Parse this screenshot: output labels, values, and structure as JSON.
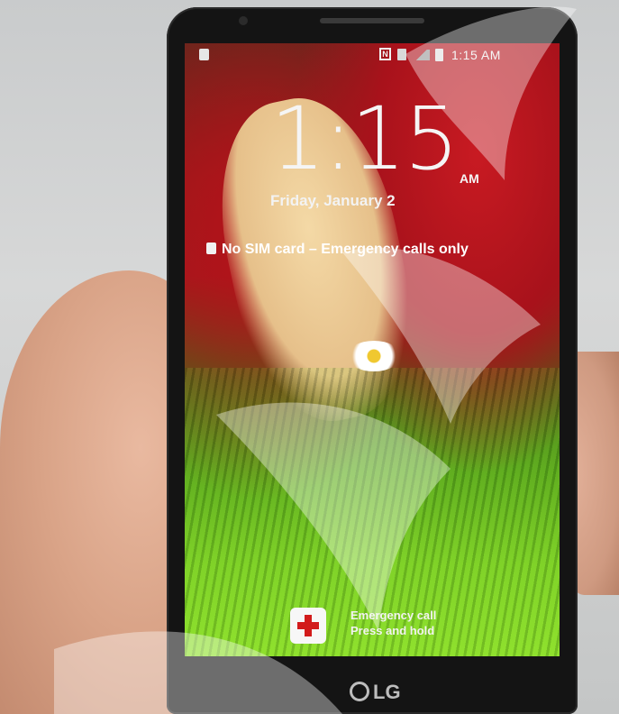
{
  "status_bar": {
    "time": "1:15 AM"
  },
  "lock_screen": {
    "clock_time": "1:15",
    "clock_ampm": "AM",
    "date": "Friday, January 2",
    "carrier_status": "No SIM card – Emergency calls only"
  },
  "emergency": {
    "line1": "Emergency call",
    "line2": "Press and hold"
  },
  "hardware": {
    "brand": "LG"
  },
  "colors": {
    "emergency_red": "#d21b1b",
    "text_white": "#f5f5f5"
  }
}
